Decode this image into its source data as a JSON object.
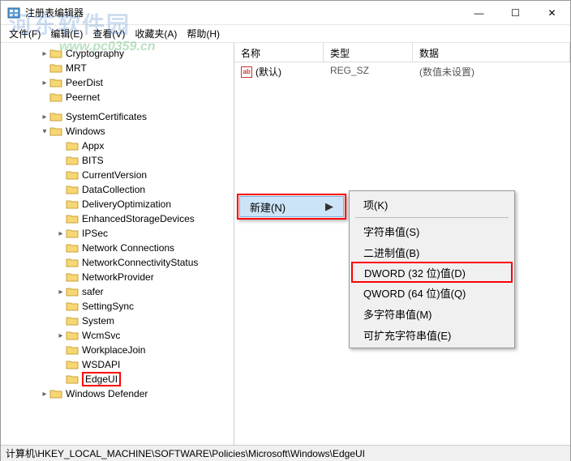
{
  "window": {
    "title": "注册表编辑器"
  },
  "menubar": {
    "file": "文件(F)",
    "edit": "编辑(E)",
    "view": "查看(V)",
    "favorites": "收藏夹(A)",
    "help": "帮助(H)"
  },
  "tree": {
    "items": [
      {
        "indent": 2,
        "expander": ">",
        "label": "Cryptography"
      },
      {
        "indent": 2,
        "expander": "",
        "label": "MRT"
      },
      {
        "indent": 2,
        "expander": ">",
        "label": "PeerDist"
      },
      {
        "indent": 2,
        "expander": "",
        "label": "Peernet"
      },
      {
        "indent": 2,
        "expander": ">",
        "label": "SystemCertificates"
      },
      {
        "indent": 2,
        "expander": "v",
        "label": "Windows"
      },
      {
        "indent": 3,
        "expander": "",
        "label": "Appx"
      },
      {
        "indent": 3,
        "expander": "",
        "label": "BITS"
      },
      {
        "indent": 3,
        "expander": "",
        "label": "CurrentVersion"
      },
      {
        "indent": 3,
        "expander": "",
        "label": "DataCollection"
      },
      {
        "indent": 3,
        "expander": "",
        "label": "DeliveryOptimization"
      },
      {
        "indent": 3,
        "expander": "",
        "label": "EnhancedStorageDevices"
      },
      {
        "indent": 3,
        "expander": ">",
        "label": "IPSec"
      },
      {
        "indent": 3,
        "expander": "",
        "label": "Network Connections"
      },
      {
        "indent": 3,
        "expander": "",
        "label": "NetworkConnectivityStatus"
      },
      {
        "indent": 3,
        "expander": "",
        "label": "NetworkProvider"
      },
      {
        "indent": 3,
        "expander": ">",
        "label": "safer"
      },
      {
        "indent": 3,
        "expander": "",
        "label": "SettingSync"
      },
      {
        "indent": 3,
        "expander": "",
        "label": "System"
      },
      {
        "indent": 3,
        "expander": ">",
        "label": "WcmSvc"
      },
      {
        "indent": 3,
        "expander": "",
        "label": "WorkplaceJoin"
      },
      {
        "indent": 3,
        "expander": "",
        "label": "WSDAPI"
      },
      {
        "indent": 3,
        "expander": "",
        "label": "EdgeUI",
        "highlighted": true
      },
      {
        "indent": 2,
        "expander": ">",
        "label": "Windows Defender"
      }
    ]
  },
  "list": {
    "columns": {
      "name": "名称",
      "type": "类型",
      "data": "数据"
    },
    "rows": [
      {
        "name": "(默认)",
        "type": "REG_SZ",
        "data": "(数值未设置)"
      }
    ]
  },
  "context_primary": {
    "new": "新建(N)",
    "arrow": "▶"
  },
  "context_secondary": {
    "key": "项(K)",
    "string": "字符串值(S)",
    "binary": "二进制值(B)",
    "dword": "DWORD (32 位)值(D)",
    "qword": "QWORD (64 位)值(Q)",
    "multi": "多字符串值(M)",
    "expand": "可扩充字符串值(E)"
  },
  "statusbar": {
    "path": "计算机\\HKEY_LOCAL_MACHINE\\SOFTWARE\\Policies\\Microsoft\\Windows\\EdgeUI"
  },
  "watermark": {
    "text1": "河东软件园",
    "text2": "www.pc0359.cn"
  }
}
